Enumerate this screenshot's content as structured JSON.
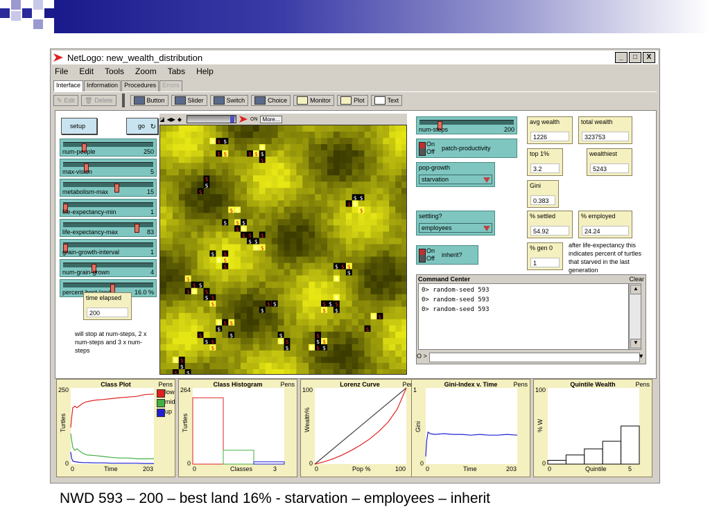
{
  "window": {
    "title": "NetLogo: new_wealth_distribution",
    "controls": [
      "_",
      "□",
      "X"
    ]
  },
  "menu": [
    "File",
    "Edit",
    "Tools",
    "Zoom",
    "Tabs",
    "Help"
  ],
  "tabs": [
    "Interface",
    "Information",
    "Procedures",
    "Errors"
  ],
  "toolbar": {
    "edit": "Edit",
    "delete": "Delete",
    "button": "Button",
    "slider": "Slider",
    "switch": "Switch",
    "choice": "Choice",
    "monitor": "Monitor",
    "plot": "Plot",
    "text": "Text"
  },
  "buttons": {
    "setup": "setup",
    "go": "go"
  },
  "sliders": [
    {
      "label": "num-people",
      "value": "250",
      "pos": 0.22
    },
    {
      "label": "max-vision",
      "value": "5",
      "pos": 0.24
    },
    {
      "label": "metabolism-max",
      "value": "15",
      "pos": 0.6
    },
    {
      "label": "life-expectancy-min",
      "value": "1",
      "pos": 0.0
    },
    {
      "label": "life-expectancy-max",
      "value": "83",
      "pos": 0.83
    },
    {
      "label": "grain-growth-interval",
      "value": "1",
      "pos": 0.0
    },
    {
      "label": "num-grain-grown",
      "value": "4",
      "pos": 0.33
    },
    {
      "label": "percent-best-land",
      "value": "16.0 %",
      "pos": 0.55
    }
  ],
  "num_steps": {
    "label": "num-steps",
    "value": "200",
    "pos": 0.2
  },
  "time_elapsed": {
    "label": "time elapsed",
    "value": "200"
  },
  "note_steps": "will stop at num-steps, 2 x num-steps and 3 x num-steps",
  "view": {
    "more": "More..."
  },
  "switches": {
    "patch_productivity": {
      "label": "patch-productivity",
      "on": "On",
      "off": "Off"
    },
    "inherit": {
      "label": "inherit?",
      "on": "On",
      "off": "Off"
    }
  },
  "choosers": {
    "pop_growth": {
      "label": "pop-growth",
      "value": "starvation"
    },
    "settling": {
      "label": "settling?",
      "value": "employees"
    }
  },
  "monitors": {
    "avg_wealth": {
      "label": "avg wealth",
      "value": "1226"
    },
    "total_wealth": {
      "label": "total wealth",
      "value": "323753"
    },
    "top1": {
      "label": "top 1%",
      "value": "3.2"
    },
    "wealthiest": {
      "label": "wealthiest",
      "value": "5243"
    },
    "gini": {
      "label": "Gini",
      "value": "0.383"
    },
    "settled": {
      "label": "% settled",
      "value": "54.92"
    },
    "employed": {
      "label": "% employed",
      "value": "24.24"
    },
    "gen0": {
      "label": "% gen 0",
      "value": "1"
    }
  },
  "note_life": "after life-expectancy this indicates percent of turtles that starved in the last generation",
  "command_center": {
    "title": "Command Center",
    "clear": "Clear",
    "lines": [
      "0> random-seed 593",
      "0> random-seed 593",
      "0> random-seed 593"
    ],
    "prompt": "O >"
  },
  "chart_data": [
    {
      "type": "line",
      "title": "Class Plot",
      "pens": "Pens",
      "xlabel": "Time",
      "ylabel": "Turtles",
      "xlim": [
        0,
        203
      ],
      "ylim": [
        0,
        250
      ],
      "legend": [
        "low",
        "mid",
        "up"
      ],
      "colors": [
        "#e02020",
        "#40b040",
        "#2020d0"
      ],
      "series": [
        {
          "name": "low",
          "x": [
            0,
            2,
            5,
            10,
            15,
            20,
            30,
            40,
            60,
            80,
            100,
            120,
            140,
            160,
            180,
            203
          ],
          "y": [
            120,
            150,
            185,
            190,
            185,
            190,
            200,
            205,
            210,
            212,
            215,
            218,
            220,
            222,
            228,
            230
          ]
        },
        {
          "name": "mid",
          "x": [
            0,
            2,
            5,
            10,
            15,
            20,
            30,
            40,
            60,
            80,
            100,
            120,
            140,
            160,
            180,
            203
          ],
          "y": [
            100,
            80,
            55,
            45,
            50,
            45,
            35,
            30,
            28,
            25,
            22,
            20,
            20,
            18,
            17,
            18
          ]
        },
        {
          "name": "up",
          "x": [
            0,
            2,
            5,
            10,
            15,
            20,
            30,
            40,
            60,
            80,
            100,
            120,
            140,
            160,
            180,
            203
          ],
          "y": [
            40,
            20,
            10,
            8,
            7,
            6,
            5,
            5,
            4,
            4,
            3,
            3,
            3,
            3,
            2,
            2
          ]
        }
      ]
    },
    {
      "type": "bar",
      "title": "Class Histogram",
      "pens": "Pens",
      "xlabel": "Classes",
      "ylabel": "Turtles",
      "xlim": [
        0,
        3
      ],
      "ylim": [
        0,
        264
      ],
      "categories": [
        "low",
        "mid",
        "up"
      ],
      "values": [
        230,
        48,
        8
      ],
      "colors": [
        "#e02020",
        "#40b040",
        "#2020d0"
      ]
    },
    {
      "type": "line",
      "title": "Lorenz Curve",
      "pens": "Pens",
      "xlabel": "Pop %",
      "ylabel": "Wealth%",
      "xlim": [
        0,
        100
      ],
      "ylim": [
        0,
        100
      ],
      "series": [
        {
          "name": "equal",
          "x": [
            0,
            100
          ],
          "y": [
            0,
            100
          ]
        },
        {
          "name": "lorenz",
          "x": [
            0,
            10,
            20,
            30,
            40,
            50,
            60,
            70,
            80,
            90,
            100
          ],
          "y": [
            0,
            3,
            7,
            12,
            18,
            25,
            33,
            43,
            55,
            72,
            100
          ]
        }
      ]
    },
    {
      "type": "line",
      "title": "Gini-Index v. Time",
      "pens": "Pens",
      "xlabel": "Time",
      "ylabel": "Gini",
      "xlim": [
        0,
        203
      ],
      "ylim": [
        0,
        1
      ],
      "series": [
        {
          "name": "gini",
          "x": [
            0,
            2,
            5,
            10,
            20,
            40,
            60,
            80,
            100,
            120,
            140,
            160,
            180,
            203
          ],
          "y": [
            0.1,
            0.3,
            0.42,
            0.4,
            0.39,
            0.4,
            0.39,
            0.39,
            0.38,
            0.39,
            0.38,
            0.38,
            0.39,
            0.38
          ]
        }
      ]
    },
    {
      "type": "bar",
      "title": "Quintile Wealth",
      "pens": "Pens",
      "xlabel": "Quintile",
      "ylabel": "% W",
      "xlim": [
        0,
        5
      ],
      "ylim": [
        0,
        100
      ],
      "categories": [
        "1",
        "2",
        "3",
        "4",
        "5"
      ],
      "values": [
        5,
        12,
        20,
        30,
        50
      ]
    }
  ],
  "caption": "NWD 593 – 200 – best land 16% - starvation – employees – inherit"
}
